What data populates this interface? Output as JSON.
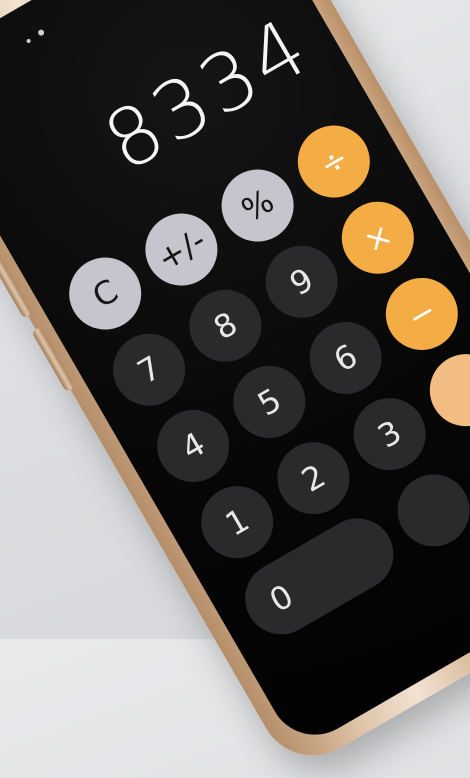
{
  "calculator": {
    "display": "8334",
    "rows": [
      [
        {
          "label": "C",
          "name": "clear-button",
          "kind": "fn"
        },
        {
          "label": "+/-",
          "name": "sign-toggle-button",
          "kind": "fn"
        },
        {
          "label": "%",
          "name": "percent-button",
          "kind": "fn"
        },
        {
          "label": "÷",
          "name": "divide-button",
          "kind": "op"
        }
      ],
      [
        {
          "label": "7",
          "name": "digit-7-button",
          "kind": "num"
        },
        {
          "label": "8",
          "name": "digit-8-button",
          "kind": "num"
        },
        {
          "label": "9",
          "name": "digit-9-button",
          "kind": "num"
        },
        {
          "label": "×",
          "name": "multiply-button",
          "kind": "op"
        }
      ],
      [
        {
          "label": "4",
          "name": "digit-4-button",
          "kind": "num"
        },
        {
          "label": "5",
          "name": "digit-5-button",
          "kind": "num"
        },
        {
          "label": "6",
          "name": "digit-6-button",
          "kind": "num"
        },
        {
          "label": "−",
          "name": "subtract-button",
          "kind": "op"
        }
      ],
      [
        {
          "label": "1",
          "name": "digit-1-button",
          "kind": "num"
        },
        {
          "label": "2",
          "name": "digit-2-button",
          "kind": "num"
        },
        {
          "label": "3",
          "name": "digit-3-button",
          "kind": "num"
        },
        {
          "label": "",
          "name": "add-button",
          "kind": "op"
        }
      ],
      [
        {
          "label": "0",
          "name": "digit-0-button",
          "kind": "num",
          "wide": true
        },
        {
          "label": "",
          "name": "decimal-button",
          "kind": "num"
        },
        {
          "label": "",
          "name": "equals-button",
          "kind": "op"
        }
      ]
    ]
  }
}
